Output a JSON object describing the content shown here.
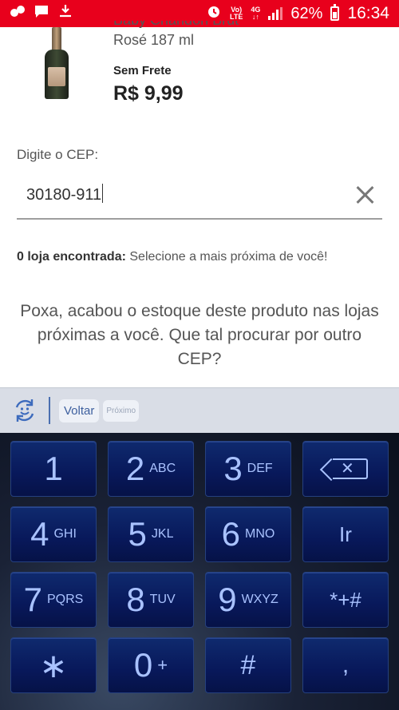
{
  "status_bar": {
    "volte_top": "Vo)",
    "volte_bottom": "LTE",
    "network_top": "4G",
    "network_bottom": "↓↑",
    "battery": "62%",
    "time": "16:34"
  },
  "product": {
    "name_line1": "Baby Chandon Brut",
    "name_line2": "Rosé 187 ml",
    "shipping": "Sem Frete",
    "price": "R$ 9,99"
  },
  "cep": {
    "label": "Digite o CEP:",
    "value": "30180-911"
  },
  "stores": {
    "count_label": "0 loja encontrada:",
    "hint": " Selecione a mais próxima de você!"
  },
  "empty_message": "Poxa, acabou o estoque deste produto nas lojas próximas a você. Que tal procurar por outro CEP?",
  "keyboard_toolbar": {
    "back_label": "Voltar",
    "next_label": "Próximo"
  },
  "keyboard": {
    "keys": [
      {
        "main": "1",
        "sub": ""
      },
      {
        "main": "2",
        "sub": "ABC"
      },
      {
        "main": "3",
        "sub": "DEF"
      },
      {
        "main": "4",
        "sub": "GHI"
      },
      {
        "main": "5",
        "sub": "JKL"
      },
      {
        "main": "6",
        "sub": "MNO"
      },
      {
        "main": "Ir",
        "sub": ""
      },
      {
        "main": "7",
        "sub": "PQRS"
      },
      {
        "main": "8",
        "sub": "TUV"
      },
      {
        "main": "9",
        "sub": "WXYZ"
      },
      {
        "main": "*+#",
        "sub": ""
      },
      {
        "main": "∗",
        "sub": ""
      },
      {
        "main": "0",
        "sub": "+"
      },
      {
        "main": "#",
        "sub": ""
      },
      {
        "main": ",",
        "sub": ""
      }
    ]
  },
  "colors": {
    "status_bar": "#e8001c",
    "key_text": "#a9c2ff",
    "toolbar_accent": "#3d5f9e"
  }
}
